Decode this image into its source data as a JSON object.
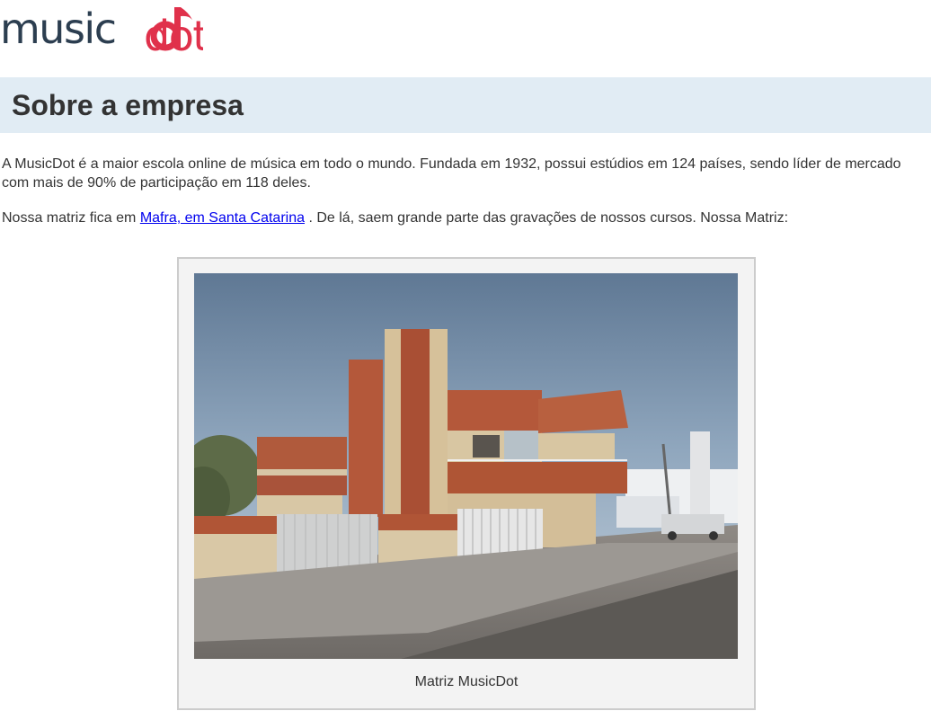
{
  "logo": {
    "text_main": "music",
    "text_accent": "dot"
  },
  "header": {
    "title": "Sobre a empresa"
  },
  "content": {
    "paragraph1": "A MusicDot é a maior escola online de música em todo o mundo. Fundada em 1932, possui estúdios em 124 países, sendo líder de mercado com mais de 90% de participação em 118 deles.",
    "paragraph2_before": "Nossa matriz fica em ",
    "paragraph2_link": "Mafra, em Santa Catarina",
    "paragraph2_after": " . De lá, saem grande parte das gravações de nossos cursos. Nossa Matriz:"
  },
  "figure": {
    "caption": "Matriz MusicDot"
  },
  "colors": {
    "brand_dark": "#2c3e50",
    "brand_accent": "#e0314b",
    "title_bg": "#e1ecf4",
    "link": "#0000ee"
  },
  "icons": {
    "logo_note": "music-note-icon"
  }
}
